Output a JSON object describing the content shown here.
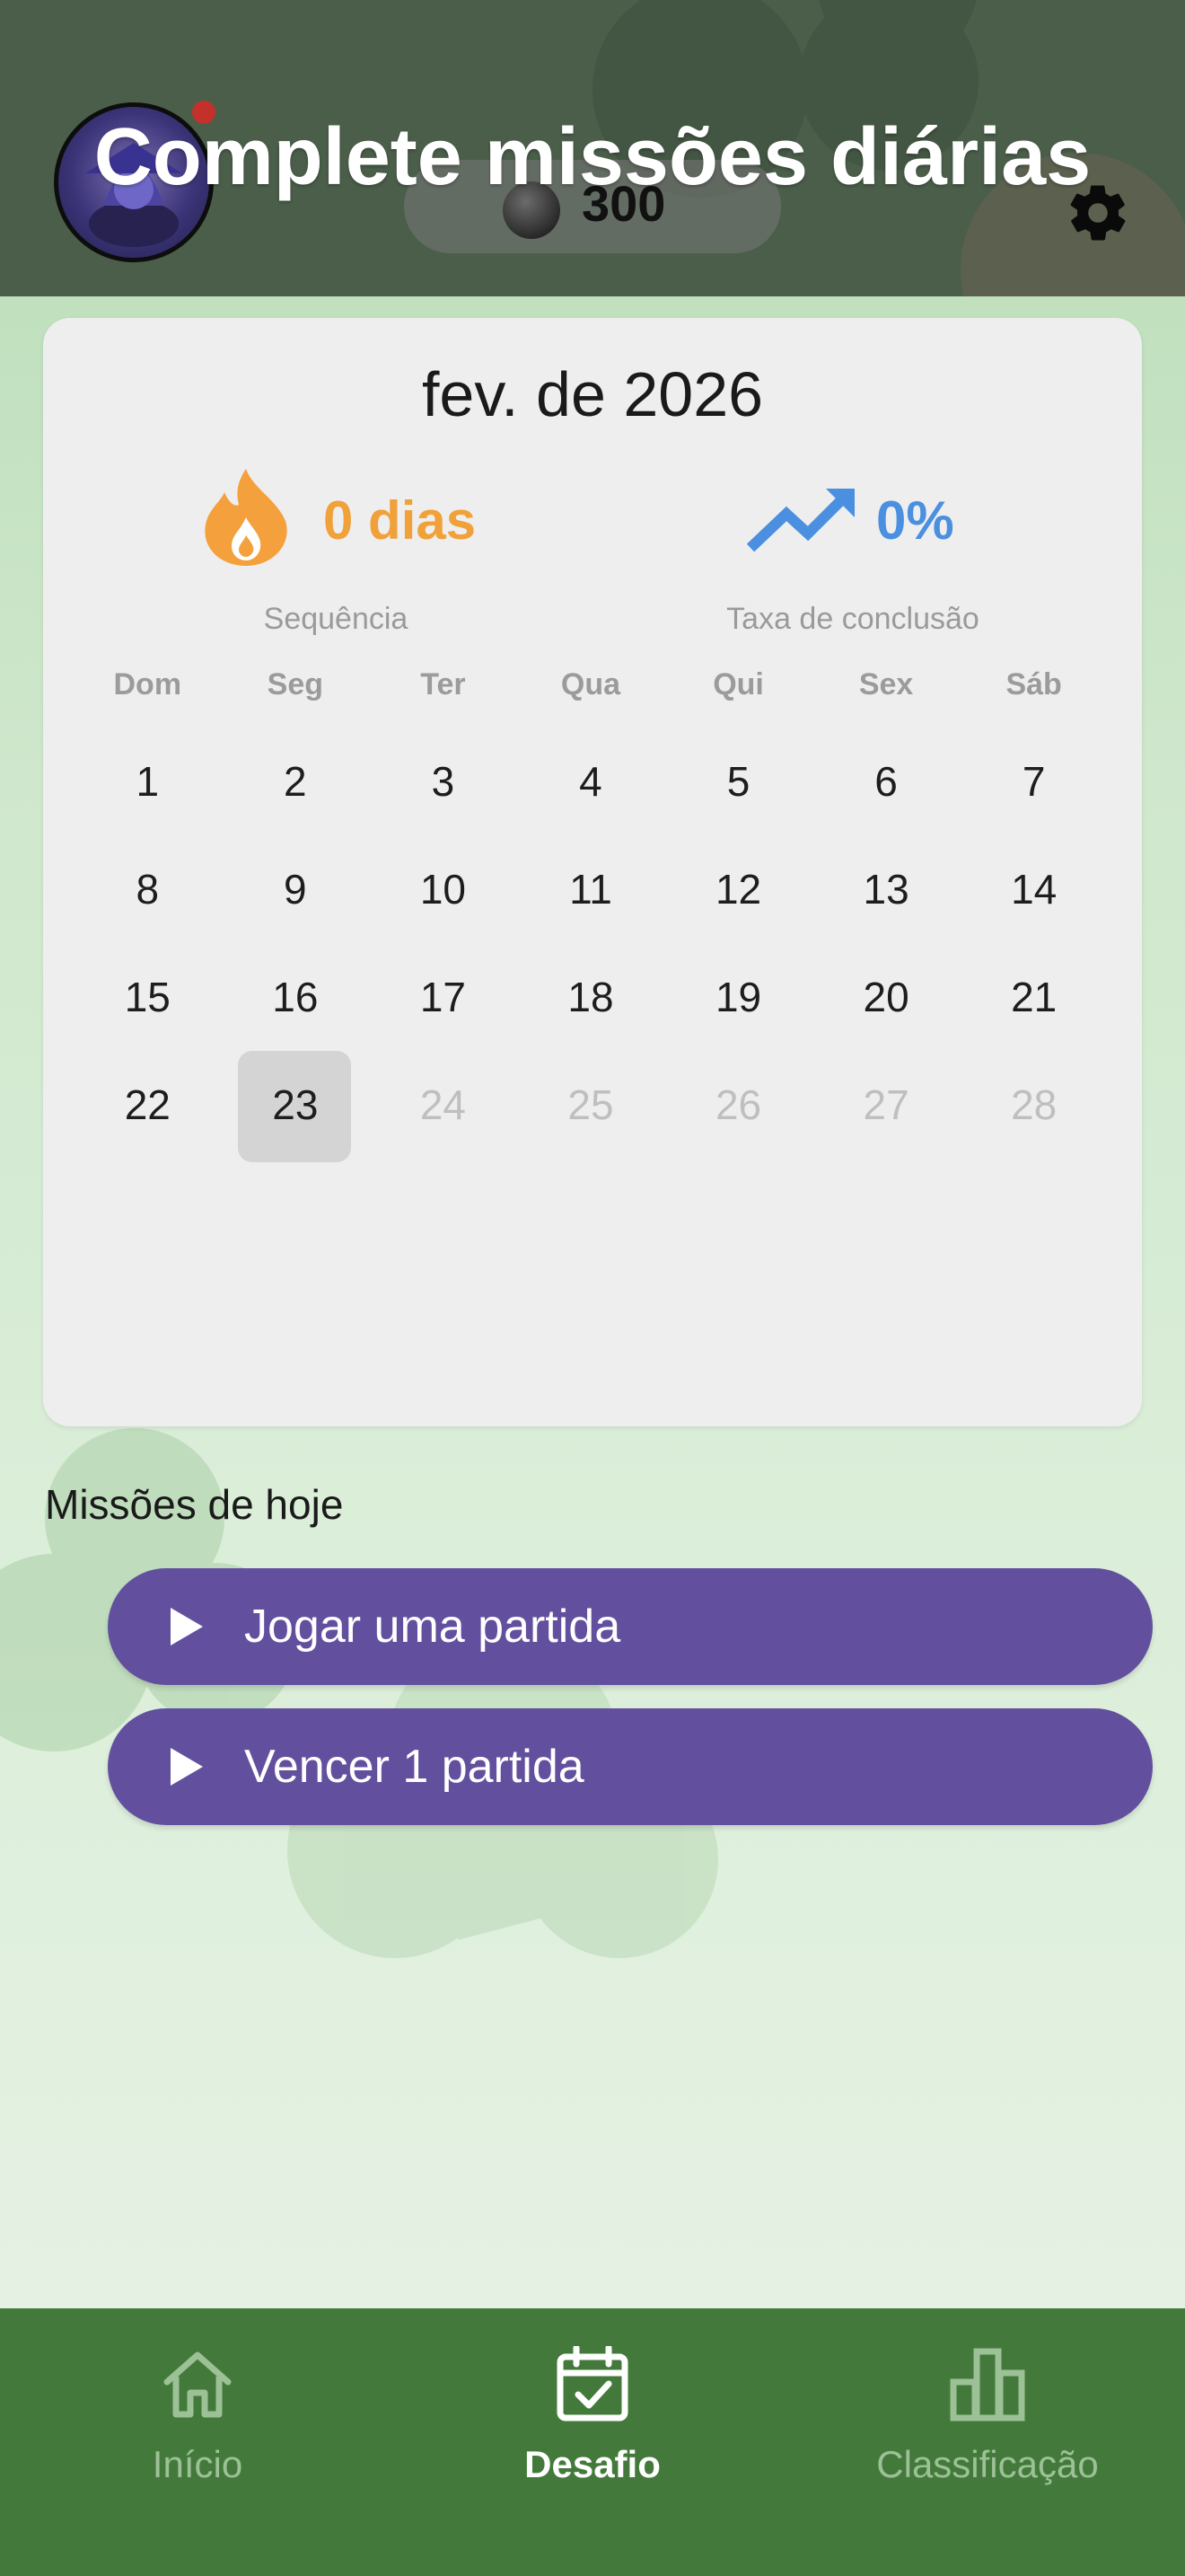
{
  "header": {
    "title": "Complete missões diárias",
    "coins": "300",
    "avatar_icon": "wizard-avatar",
    "settings_icon": "gear-icon"
  },
  "calendar": {
    "month_label": "fev. de 2026",
    "streak": {
      "value": "0 dias",
      "label": "Sequência",
      "icon": "flame-icon",
      "color": "#f0a13a"
    },
    "completion": {
      "value": "0%",
      "label": "Taxa de conclusão",
      "icon": "trend-icon",
      "color": "#4a8fe0"
    },
    "weekdays": [
      "Dom",
      "Seg",
      "Ter",
      "Qua",
      "Qui",
      "Sex",
      "Sáb"
    ],
    "weeks": [
      [
        "1",
        "2",
        "3",
        "4",
        "5",
        "6",
        "7"
      ],
      [
        "8",
        "9",
        "10",
        "11",
        "12",
        "13",
        "14"
      ],
      [
        "15",
        "16",
        "17",
        "18",
        "19",
        "20",
        "21"
      ],
      [
        "22",
        "23",
        "24",
        "25",
        "26",
        "27",
        "28"
      ]
    ],
    "today": "23"
  },
  "missions": {
    "title": "Missões de hoje",
    "items": [
      {
        "label": "Jogar uma partida",
        "icon": "play-icon"
      },
      {
        "label": "Vencer 1 partida",
        "icon": "play-icon"
      }
    ]
  },
  "nav": {
    "items": [
      {
        "label": "Início",
        "icon": "home-icon"
      },
      {
        "label": "Desafio",
        "icon": "calendar-check-icon",
        "active": true
      },
      {
        "label": "Classificação",
        "icon": "bar-chart-icon"
      }
    ]
  },
  "colors": {
    "header_bg": "#4a5e4a",
    "mission_button": "#62509e",
    "nav_bg": "#437a3b",
    "streak": "#f0a13a",
    "rate": "#4a8fe0"
  }
}
